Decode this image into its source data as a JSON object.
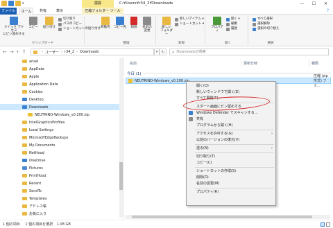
{
  "window": {
    "title": "C:¥Users¥r34_2¥Downloads",
    "manage_tab": "展開",
    "controls": [
      "—",
      "☐",
      "✕"
    ]
  },
  "ribbon_tabs": {
    "file": "ファイル",
    "home": "ホーム",
    "share": "共有",
    "view": "表示",
    "tools": "圧縮フォルダー ツール"
  },
  "ribbon": {
    "clipboard": {
      "pin": "クイック アクセス\nにピン留めする",
      "copy": "コピー",
      "paste": "貼り付け",
      "cut": "切り取り",
      "copy_path": "パスのコピー",
      "paste_shortcut": "ショートカットの貼り付け",
      "label": "クリップボード"
    },
    "organize": {
      "move_to": "移動先",
      "copy_to": "コピー先",
      "delete": "削除",
      "rename": "名前の\n変更",
      "label": "整理"
    },
    "new": {
      "new_folder": "新しい\nフォルダー",
      "new_item": "新しいアイテム ▾",
      "shortcut": "ショートカット ▾",
      "label": "新規"
    },
    "open": {
      "properties": "プロパティ",
      "open": "開く ▾",
      "edit": "編集",
      "history": "履歴",
      "label": "開く"
    },
    "select": {
      "select_all": "すべて選択",
      "select_none": "選択解除",
      "invert": "選択の切り替え",
      "label": "選択"
    }
  },
  "address": {
    "back": "←",
    "forward": "→",
    "dropdown": "▾",
    "up": "↑",
    "crumbs": [
      "ユーザー",
      "r34_2",
      "Downloads"
    ],
    "crumb_sep": "›",
    "search_placeholder": "Downloadsの検索"
  },
  "nav": {
    "items": [
      {
        "label": "ansel",
        "icon": "folder-icon"
      },
      {
        "label": "AppData",
        "icon": "folder-icon"
      },
      {
        "label": "Apple",
        "icon": "folder-icon"
      },
      {
        "label": "Application Data",
        "icon": "folder-icon"
      },
      {
        "label": "Cookies",
        "icon": "folder-icon"
      },
      {
        "label": "Desktop",
        "icon": "desktop-icon"
      },
      {
        "label": "Downloads",
        "icon": "download-icon",
        "selected": true
      },
      {
        "label": "NEUTRINO-Windows_v0.200.zip",
        "icon": "zip-icon"
      },
      {
        "label": "IntelGraphicsProfiles",
        "icon": "folder-icon"
      },
      {
        "label": "Local Settings",
        "icon": "folder-icon"
      },
      {
        "label": "MicrosoftEdgeBackups",
        "icon": "folder-icon"
      },
      {
        "label": "My Documents",
        "icon": "folder-icon"
      },
      {
        "label": "NetHood",
        "icon": "folder-icon"
      },
      {
        "label": "OneDrive",
        "icon": "cloud-icon"
      },
      {
        "label": "Pictures",
        "icon": "pictures-icon"
      },
      {
        "label": "PrintHood",
        "icon": "folder-icon"
      },
      {
        "label": "Recent",
        "icon": "folder-icon"
      },
      {
        "label": "SendTo",
        "icon": "folder-icon"
      },
      {
        "label": "Templates",
        "icon": "folder-icon"
      },
      {
        "label": "アドレス帳",
        "icon": "folder-icon"
      },
      {
        "label": "お気に入り",
        "icon": "star-icon"
      }
    ]
  },
  "content": {
    "columns": {
      "name": "名前",
      "date": "更新日時",
      "type": "種類"
    },
    "group": "今日 (1)",
    "file": {
      "name": "NEUTRINO-Windows_v0.200.zip",
      "type": "圧縮 (zip 形式) フォ..."
    }
  },
  "context_menu": {
    "items": [
      {
        "label": "開く(O)"
      },
      {
        "label": "新しいウィンドウで開く(E)"
      },
      {
        "label": "すべて展開(T)..."
      },
      {
        "label": "スタート画面にピン留めする"
      },
      {
        "label": "Windows Defender でスキャンする..."
      },
      {
        "label": "共有"
      },
      {
        "label": "プログラムから開く(H)"
      },
      {
        "label": "アクセスを許可する(G)",
        "submenu": true
      },
      {
        "label": "以前のバージョンの復元(V)"
      },
      {
        "label": "送る(N)",
        "submenu": true
      },
      {
        "label": "切り取り(T)"
      },
      {
        "label": "コピー(C)"
      },
      {
        "label": "ショートカットの作成(S)"
      },
      {
        "label": "削除(D)"
      },
      {
        "label": "名前の変更(M)"
      },
      {
        "label": "プロパティ(R)"
      }
    ]
  },
  "status": {
    "count": "1 個の項目",
    "selected": "1 個の項目を選択",
    "size": "1.08 GB"
  },
  "colors": {
    "accent": "#1a5fb4",
    "selection": "#cce8ff",
    "highlight_circle": "#d31a1a",
    "manage_tab": "#f8e88a"
  }
}
